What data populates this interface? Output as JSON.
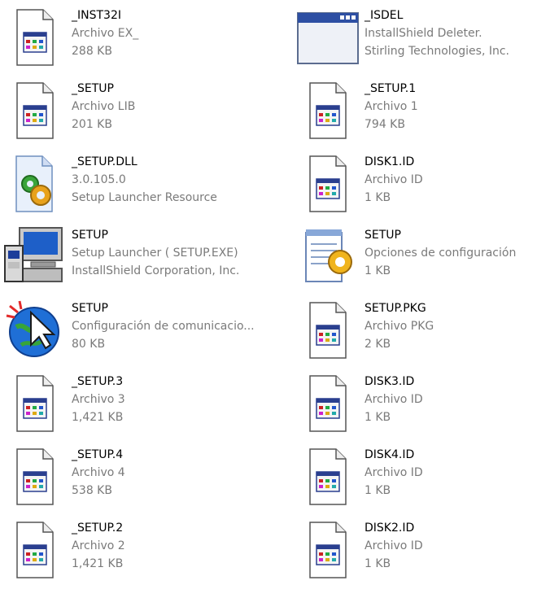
{
  "files": [
    {
      "icon": "generic-file-icon",
      "name": "_INST32I",
      "desc": "Archivo EX_",
      "size": "288 KB"
    },
    {
      "icon": "window-app-icon",
      "name": "_ISDEL",
      "desc": "InstallShield Deleter.",
      "size": "Stirling Technologies, Inc."
    },
    {
      "icon": "generic-file-icon",
      "name": "_SETUP",
      "desc": "Archivo LIB",
      "size": "201 KB"
    },
    {
      "icon": "generic-file-icon",
      "name": "_SETUP.1",
      "desc": "Archivo 1",
      "size": "794 KB"
    },
    {
      "icon": "dll-gear-icon",
      "name": "_SETUP.DLL",
      "desc": "3.0.105.0",
      "size": "Setup Launcher Resource"
    },
    {
      "icon": "generic-file-icon",
      "name": "DISK1.ID",
      "desc": "Archivo ID",
      "size": "1 KB"
    },
    {
      "icon": "setup-computer-icon",
      "name": "SETUP",
      "desc": "Setup Launcher ( SETUP.EXE)",
      "size": "InstallShield Corporation, Inc."
    },
    {
      "icon": "notepad-gear-icon",
      "name": "SETUP",
      "desc": "Opciones de configuración",
      "size": "1 KB"
    },
    {
      "icon": "globe-cursor-icon",
      "name": "SETUP",
      "desc": "Configuración de comunicacio...",
      "size": "80 KB"
    },
    {
      "icon": "generic-file-icon",
      "name": "SETUP.PKG",
      "desc": "Archivo PKG",
      "size": "2 KB"
    },
    {
      "icon": "generic-file-icon",
      "name": "_SETUP.3",
      "desc": "Archivo 3",
      "size": "1,421 KB"
    },
    {
      "icon": "generic-file-icon",
      "name": "DISK3.ID",
      "desc": "Archivo ID",
      "size": "1 KB"
    },
    {
      "icon": "generic-file-icon",
      "name": "_SETUP.4",
      "desc": "Archivo 4",
      "size": "538 KB"
    },
    {
      "icon": "generic-file-icon",
      "name": "DISK4.ID",
      "desc": "Archivo ID",
      "size": "1 KB"
    },
    {
      "icon": "generic-file-icon",
      "name": "_SETUP.2",
      "desc": "Archivo 2",
      "size": "1,421 KB"
    },
    {
      "icon": "generic-file-icon",
      "name": "DISK2.ID",
      "desc": "Archivo ID",
      "size": "1 KB"
    }
  ]
}
